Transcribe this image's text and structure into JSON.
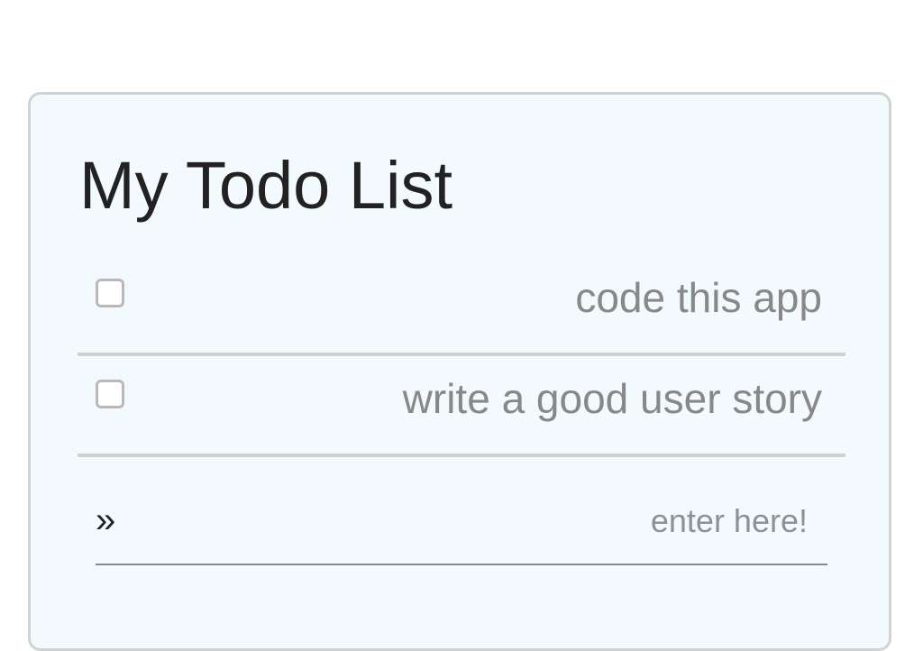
{
  "title": "My Todo List",
  "todos": [
    {
      "label": "code this app",
      "checked": false
    },
    {
      "label": "write a good user story",
      "checked": false
    }
  ],
  "input": {
    "placeholder": "enter here!",
    "value": "",
    "icon": "double-chevron-right-icon"
  }
}
